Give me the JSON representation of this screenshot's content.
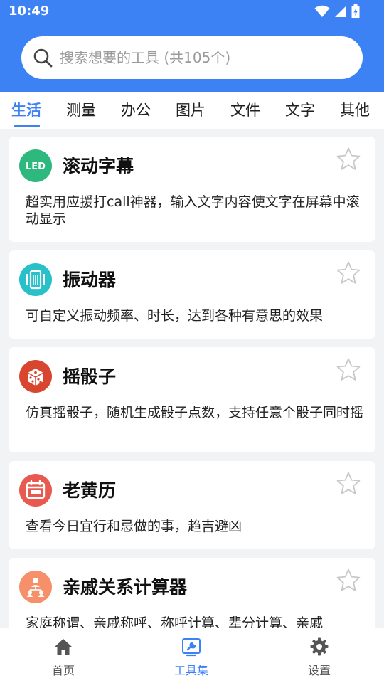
{
  "status_bar": {
    "time": "10:49"
  },
  "search": {
    "placeholder": "搜索想要的工具 (共105个)"
  },
  "tabs": [
    {
      "label": "生活",
      "active": true
    },
    {
      "label": "测量"
    },
    {
      "label": "办公"
    },
    {
      "label": "图片"
    },
    {
      "label": "文件"
    },
    {
      "label": "文字"
    },
    {
      "label": "其他"
    }
  ],
  "tools": [
    {
      "title": "滚动字幕",
      "description": "超实用应援打call神器，输入文字内容使文字在屏幕中滚动显示",
      "icon": "led-icon",
      "color": "#2db87d"
    },
    {
      "title": "振动器",
      "description": "可自定义振动频率、时长，达到各种有意思的效果",
      "icon": "vibration-icon",
      "color": "#28c1c9"
    },
    {
      "title": "摇骰子",
      "description": "仿真摇骰子，随机生成骰子点数，支持任意个骰子同时摇",
      "icon": "dice-icon",
      "color": "#d8462f"
    },
    {
      "title": "老黄历",
      "description": "查看今日宜行和忌做的事，趋吉避凶",
      "icon": "calendar-icon",
      "color": "#e85a4f"
    },
    {
      "title": "亲戚关系计算器",
      "description": "家庭称谓、亲戚称呼、称呼计算、辈分计算、亲戚",
      "icon": "family-tree-icon",
      "color": "#f5906a"
    }
  ],
  "bottom_nav": [
    {
      "label": "首页",
      "icon": "home-icon"
    },
    {
      "label": "工具集",
      "icon": "toolbox-icon",
      "active": true
    },
    {
      "label": "设置",
      "icon": "gear-icon"
    }
  ],
  "colors": {
    "primary": "#3c82f5",
    "background": "#f2f3f5",
    "star": "#c8c8c8"
  }
}
